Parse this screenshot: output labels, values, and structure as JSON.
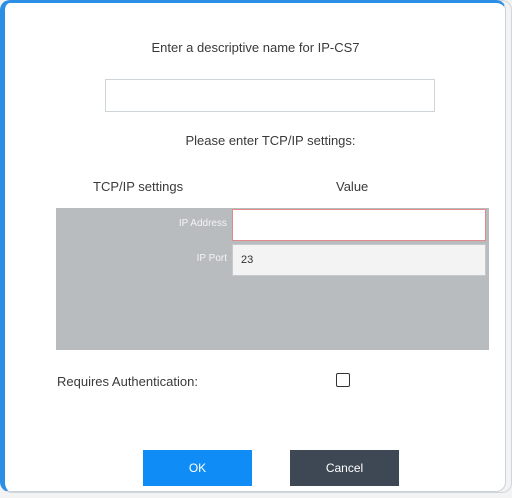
{
  "dialog": {
    "name_prompt": "Enter a descriptive name for IP-CS7",
    "name_value": "",
    "tcp_prompt": "Please enter TCP/IP settings:",
    "columns": {
      "setting": "TCP/IP settings",
      "value": "Value"
    },
    "rows": [
      {
        "label": "IP Address",
        "value": ""
      },
      {
        "label": "IP Port",
        "value": "23"
      }
    ],
    "auth_label": "Requires Authentication:",
    "auth_checked": false,
    "ok_label": "OK",
    "cancel_label": "Cancel"
  },
  "colors": {
    "accent": "#2b8fe6",
    "ok_button": "#0f8cf5",
    "cancel_button": "#3e4855",
    "grid_background": "#b8bcbf",
    "invalid_border": "#e08a8a"
  }
}
